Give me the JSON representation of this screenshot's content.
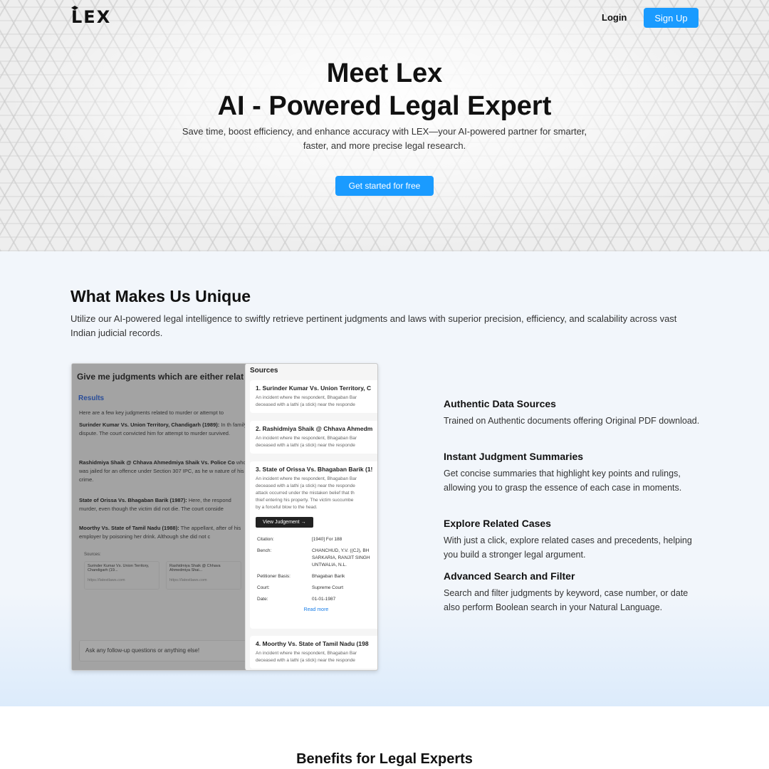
{
  "nav": {
    "logo": "LEX",
    "login": "Login",
    "signup": "Sign Up"
  },
  "hero": {
    "title_line1": "Meet Lex",
    "title_line2": "AI - Powered Legal Expert",
    "subtitle": "Save time, boost efficiency, and enhance accuracy with LEX—your AI-powered partner for smarter, faster, and more precise legal research.",
    "cta": "Get started for free"
  },
  "unique": {
    "title": "What Makes Us Unique",
    "description": "Utilize our AI-powered legal intelligence to swiftly retrieve pertinent judgments and laws with superior precision, efficiency, and scalability across vast Indian judicial records."
  },
  "mockup": {
    "question": "Give me judgments which are either relat",
    "results_label": "Results",
    "intro": "Here are a few key judgments related to murder or attempt to",
    "paragraphs": [
      {
        "title": "Surinder Kumar Vs. Union Territory, Chandigarh (1989):",
        "text": " In th family dispute. The court convicted him for attempt to murder survived."
      },
      {
        "title": "Rashidmiya Shaik @ Chhava Ahmedmiya Shaik Vs. Police Co",
        "text": " who was jailed for an offence under Section 307 IPC, as he w nature of his crime."
      },
      {
        "title": "State of Orissa Vs. Bhagaban Barik (1987):",
        "text": " Here, the respond murder, even though the victim did not die. The court conside"
      },
      {
        "title": "Moorthy Vs. State of Tamil Nadu (1988):",
        "text": " The appellant, after of his employer by poisoning her drink. Although she did not c"
      }
    ],
    "sources_label": "Sources:",
    "source_cards": [
      {
        "title": "Surinder Kumar Vs. Union Territory, Chandigarh (19...",
        "url": "https://latestlaws.com"
      },
      {
        "title": "Rashidmiya Shaik @ Chhava Ahmedmiya Shai...",
        "url": "https://latestlaws.com"
      }
    ],
    "ask_placeholder": "Ask any follow-up questions or anything else!",
    "panel": {
      "header": "Sources",
      "items": [
        {
          "title": "1. Surinder Kumar Vs. Union Territory, C",
          "snippet1": "An incident where the respondent, Bhagaban Bar",
          "snippet2": "deceased with a lathi (a stick) near the responde"
        },
        {
          "title": "2. Rashidmiya Shaik @ Chhava Ahmedm",
          "snippet1": "An incident where the respondent, Bhagaban Bar",
          "snippet2": "deceased with a lathi (a stick) near the responde"
        },
        {
          "title": "3. State of Orissa Vs. Bhagaban Barik (1!",
          "snippet1": "An incident where the respondent, Bhagaban Bar",
          "snippet2": "deceased with a lathi (a stick) near the responde",
          "snippet3": "attack occurred under the mistaken belief that th",
          "snippet4": "thief entering his property. The victim succumbe",
          "snippet5": "by a forceful blow to the head."
        },
        {
          "title": "4. Moorthy Vs. State of Tamil Nadu (198",
          "snippet1": "An incident where the respondent, Bhagaban Bar",
          "snippet2": "deceased with a lathi (a stick) near the responde"
        }
      ],
      "view_button": "View Judgement",
      "meta": {
        "citation_label": "Citation:",
        "citation": "[1940] For 188",
        "bench_label": "Bench:",
        "bench1": "CHANCHUD, Y.V. ((CJ), BH",
        "bench2": "SARKARIA, RANJIT SINGH",
        "bench3": "UNTWALIA, N.L.",
        "petitioner_label": "Petitioner Basis:",
        "petitioner": "Bhagaban Barik",
        "court_label": "Court:",
        "court": "Supreme Court",
        "date_label": "Date:",
        "date": "01-01-1987"
      },
      "read_more": "Read more"
    }
  },
  "features": [
    {
      "title": "Authentic Data Sources",
      "desc": "Trained on Authentic documents offering Original PDF download."
    },
    {
      "title": "Instant Judgment Summaries",
      "desc": "Get concise summaries that highlight key points and rulings, allowing you to grasp the essence of each case in moments."
    },
    {
      "title": "Explore Related Cases",
      "desc": "With just a click, explore related cases and precedents, helping you build a stronger legal argument."
    },
    {
      "title": "Advanced Search and Filter",
      "desc": "Search and filter judgments by keyword, case number, or date also perform Boolean search in your Natural Language."
    }
  ],
  "benefits": {
    "title": "Benefits for Legal Experts"
  },
  "colors": {
    "accent": "#1a9bff",
    "section_bg": "#f2f6fb"
  }
}
